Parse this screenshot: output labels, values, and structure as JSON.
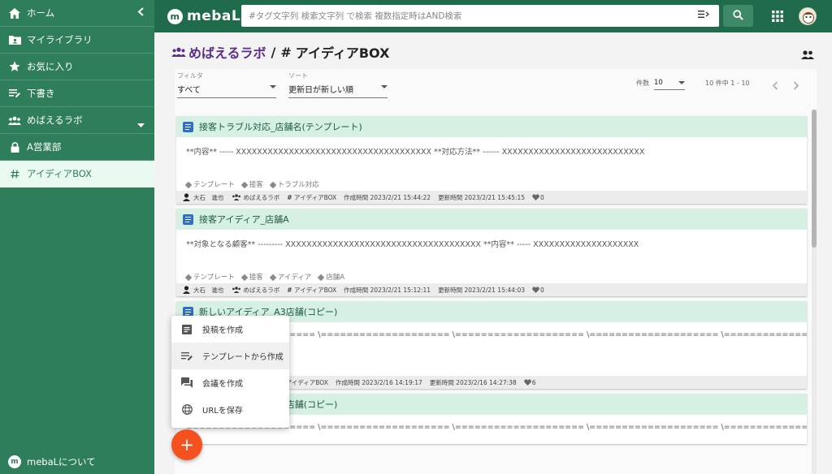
{
  "sidebar": {
    "items": [
      {
        "label": "ホーム",
        "icon": "home-icon"
      },
      {
        "label": "マイライブラリ",
        "icon": "library-icon"
      },
      {
        "label": "お気に入り",
        "icon": "star-icon"
      },
      {
        "label": "下書き",
        "icon": "draft-icon"
      },
      {
        "label": "めばえるラボ",
        "icon": "group-icon"
      },
      {
        "label": "A営業部",
        "icon": "lock-icon"
      },
      {
        "label": "アイディアBOX",
        "icon": "hash-icon"
      }
    ],
    "about_label": "mebaLについて",
    "about_logo": "m"
  },
  "topbar": {
    "brand": "mebaL",
    "brand_logo": "m",
    "search_placeholder": "#タグ文字列 検索文字列 で検索 複数指定時はAND検索"
  },
  "page": {
    "lab_name": "めばえるラボ",
    "separator": "/",
    "hash": "#",
    "box_name": "アイディアBOX"
  },
  "filters": {
    "filter_label": "フィルタ",
    "filter_value": "すべて",
    "sort_label": "ソート",
    "sort_value": "更新日が新しい順",
    "count_label": "件数",
    "count_value": "10",
    "range_text": "10 件中 1 - 10"
  },
  "cards": [
    {
      "title": "接客トラブル対応_店舗名(テンプレート)",
      "body": "**内容** ----- XXXXXXXXXXXXXXXXXXXXXXXXXXXXXXXXXXXXX **対応方法** ------ XXXXXXXXXXXXXXXXXXXXXXXXXXX",
      "tags": [
        "テンプレート",
        "接客",
        "トラブル対応"
      ],
      "author": "大石　進也",
      "group": "めばえるラボ",
      "box": "アイディアBOX",
      "created": "作成時間 2023/2/21 15:44:22",
      "updated": "更新時間 2023/2/21 15:45:15",
      "likes": "0"
    },
    {
      "title": "接客アイディア_店舗A",
      "body": "**対象となる顧客** --------- XXXXXXXXXXXXXXXXXXXXXXXXXXXXXXXXXXXXX **内容** ----- XXXXXXXXXXXXXXXXXXXX",
      "tags": [
        "テンプレート",
        "接客",
        "アイディア",
        "店舗A"
      ],
      "author": "大石　進也",
      "group": "めばえるラボ",
      "box": "アイディアBOX",
      "created": "作成時間 2023/2/21 15:12:11",
      "updated": "更新時間 2023/2/21 15:44:03",
      "likes": "0"
    },
    {
      "title": "新しいアイディア_A3店舗(コピー)",
      "body": "==================== \\==================== \\==================== \\==================== \\=================",
      "box": "アイディアBOX",
      "created": "作成時間 2023/2/16 14:19:17",
      "updated": "更新時間 2023/2/16 14:27:38",
      "likes": "6"
    },
    {
      "title": "新しいアイディア_A3店舗(コピー)",
      "body": "==================== \\==================== \\==================== \\==================== \\================="
    }
  ],
  "menu": {
    "items": [
      {
        "label": "投稿を作成",
        "icon": "post-icon"
      },
      {
        "label": "テンプレートから作成",
        "icon": "template-icon"
      },
      {
        "label": "会議を作成",
        "icon": "chat-icon"
      },
      {
        "label": "URLを保存",
        "icon": "globe-icon"
      }
    ],
    "highlighted": 1
  },
  "fab_label": "+"
}
